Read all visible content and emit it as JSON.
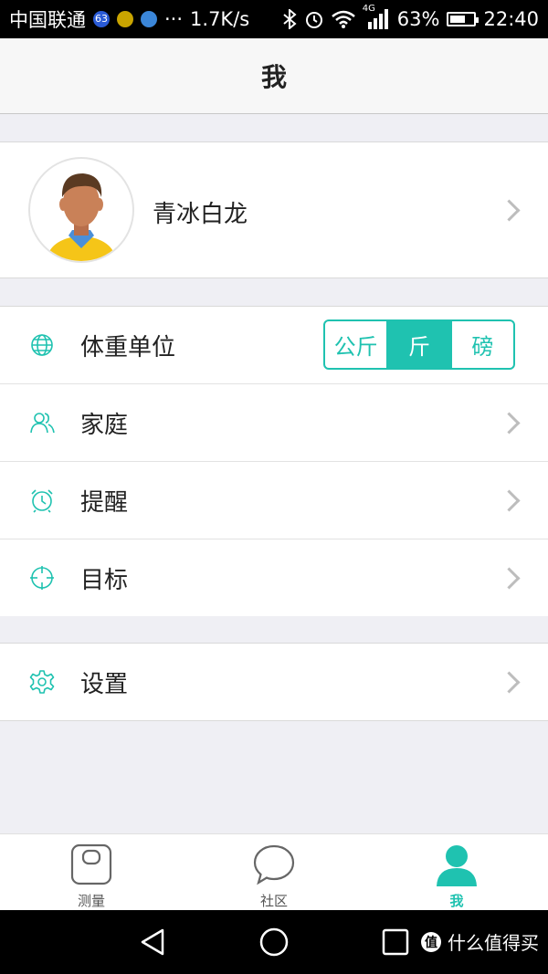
{
  "status_bar": {
    "carrier": "中国联通",
    "badge": "63",
    "more": "···",
    "speed": "1.7K/s",
    "network": "4G",
    "battery_pct": "63%",
    "battery_level": 0.63,
    "time": "22:40"
  },
  "header": {
    "title": "我"
  },
  "profile": {
    "name": "青冰白龙"
  },
  "settings": {
    "weight_unit": {
      "label": "体重单位",
      "options": [
        "公斤",
        "斤",
        "磅"
      ],
      "selected": "斤"
    },
    "family": {
      "label": "家庭"
    },
    "reminder": {
      "label": "提醒"
    },
    "goal": {
      "label": "目标"
    },
    "settings": {
      "label": "设置"
    }
  },
  "tabs": [
    {
      "label": "测量",
      "icon": "scale-icon"
    },
    {
      "label": "社区",
      "icon": "chat-bubble-icon"
    },
    {
      "label": "我",
      "icon": "person-icon"
    }
  ],
  "nav": {
    "watermark": "什么值得买"
  },
  "colors": {
    "accent": "#1fc2b0"
  }
}
